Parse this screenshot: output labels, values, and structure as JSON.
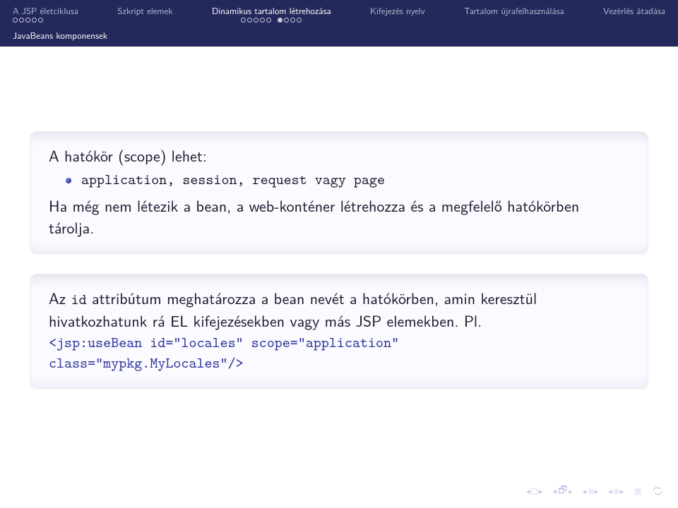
{
  "nav": {
    "items": [
      {
        "label": "A JSP életciklusa",
        "dots": {
          "total": 5,
          "filled": 0
        }
      },
      {
        "label": "Szkript elemek",
        "dots": null
      },
      {
        "label": "Dinamikus tartalom létrehozása",
        "dots": {
          "left": "○○○○○",
          "right": "●○○○"
        }
      },
      {
        "label": "Kifejezés nyelv",
        "dots": null
      },
      {
        "label": "Tartalom újrafelhasználása",
        "dots": null
      },
      {
        "label": "Vezérlés átadása",
        "dots": null
      }
    ],
    "sub": "JavaBeans komponensek"
  },
  "block1": {
    "lead": "A hatókör (scope) lehet:",
    "bullet": "application, session, request vagy page",
    "tail": "Ha még nem létezik a bean, a web-konténer létrehozza és a megfelelő hatókörben tárolja."
  },
  "block2": {
    "p1a": "Az ",
    "p1_code": "id",
    "p1b": " attribútum meghatározza a bean nevét a hatókörben, amin keresztül hivatkozhatunk rá EL kifejezésekben vagy más JSP elemekben. Pl.",
    "code1": "<jsp:useBean id=\"locales\" scope=\"application\"",
    "code2": " class=\"mypkg.MyLocales\"/>"
  },
  "footerIcons": [
    "first",
    "prev-section",
    "prev",
    "next",
    "end",
    "cycle"
  ]
}
